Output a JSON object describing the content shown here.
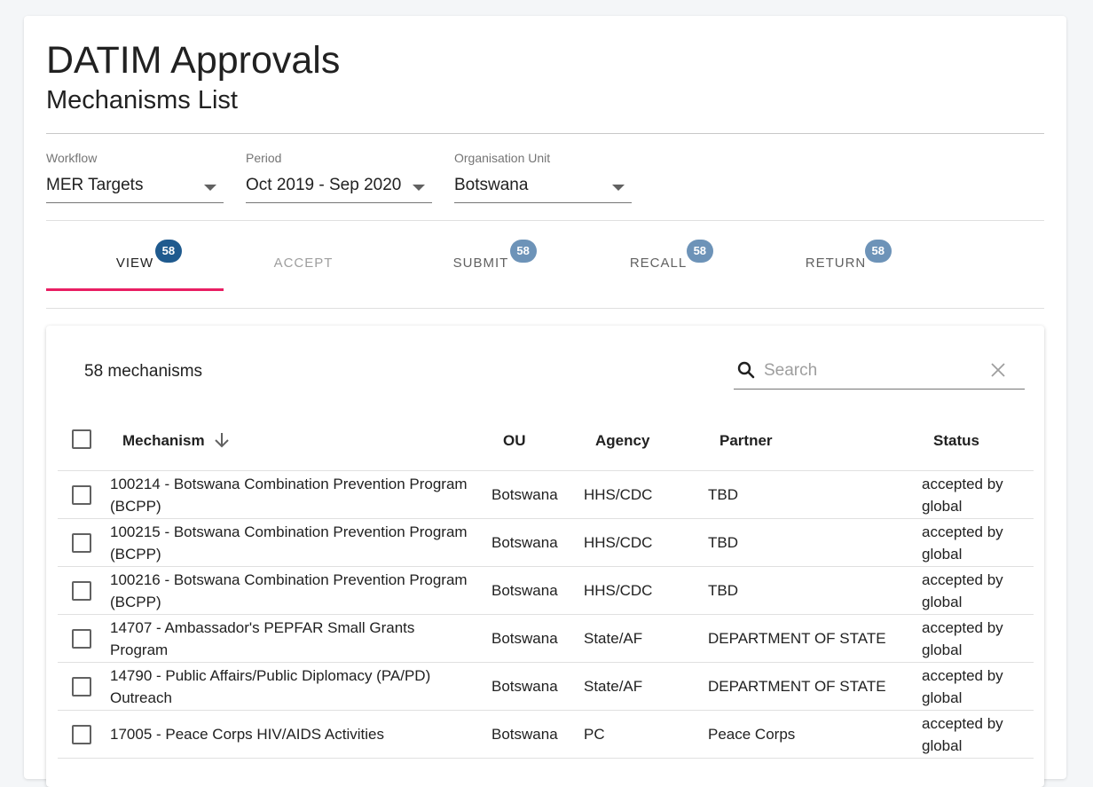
{
  "header": {
    "title": "DATIM Approvals",
    "subtitle": "Mechanisms List"
  },
  "filters": {
    "workflow": {
      "label": "Workflow",
      "value": "MER Targets"
    },
    "period": {
      "label": "Period",
      "value": "Oct 2019 - Sep 2020"
    },
    "org_unit": {
      "label": "Organisation Unit",
      "value": "Botswana"
    }
  },
  "tabs": [
    {
      "label": "VIEW",
      "count": "58",
      "state": "active",
      "badge_color": "#1f5a8e"
    },
    {
      "label": "ACCEPT",
      "count": "",
      "state": "disabled"
    },
    {
      "label": "SUBMIT",
      "count": "58",
      "state": "normal",
      "badge_color": "#6d93b8"
    },
    {
      "label": "RECALL",
      "count": "58",
      "state": "normal",
      "badge_color": "#6d93b8"
    },
    {
      "label": "RETURN",
      "count": "58",
      "state": "normal",
      "badge_color": "#6d93b8"
    }
  ],
  "colors": {
    "tab_indicator": "#e91e63"
  },
  "table": {
    "count_text": "58 mechanisms",
    "search_placeholder": "Search",
    "columns": {
      "mechanism": "Mechanism",
      "ou": "OU",
      "agency": "Agency",
      "partner": "Partner",
      "status": "Status"
    },
    "sort": "descending by Mechanism",
    "rows": [
      {
        "mechanism": "100214 - Botswana Combination Prevention Program (BCPP)",
        "ou": "Botswana",
        "agency": "HHS/CDC",
        "partner": "TBD",
        "status": "accepted by global"
      },
      {
        "mechanism": "100215 - Botswana Combination Prevention Program (BCPP)",
        "ou": "Botswana",
        "agency": "HHS/CDC",
        "partner": "TBD",
        "status": "accepted by global"
      },
      {
        "mechanism": "100216 - Botswana Combination Prevention Program (BCPP)",
        "ou": "Botswana",
        "agency": "HHS/CDC",
        "partner": "TBD",
        "status": "accepted by global"
      },
      {
        "mechanism": "14707 - Ambassador's PEPFAR Small Grants Program",
        "ou": "Botswana",
        "agency": "State/AF",
        "partner": "DEPARTMENT OF STATE",
        "status": "accepted by global"
      },
      {
        "mechanism": "14790 - Public Affairs/Public Diplomacy (PA/PD) Outreach",
        "ou": "Botswana",
        "agency": "State/AF",
        "partner": "DEPARTMENT OF STATE",
        "status": "accepted by global"
      },
      {
        "mechanism": "17005 - Peace Corps HIV/AIDS Activities",
        "ou": "Botswana",
        "agency": "PC",
        "partner": "Peace Corps",
        "status": "accepted by global"
      }
    ]
  }
}
